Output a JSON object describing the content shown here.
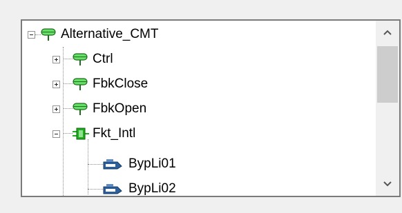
{
  "tree": {
    "items": [
      {
        "label": "Alternative_CMT",
        "icon": "signal-group-icon",
        "expanded": true
      },
      {
        "label": "Ctrl",
        "icon": "signal-group-icon",
        "expanded": false
      },
      {
        "label": "FbkClose",
        "icon": "signal-group-icon",
        "expanded": false
      },
      {
        "label": "FbkOpen",
        "icon": "signal-group-icon",
        "expanded": false
      },
      {
        "label": "Fkt_Intl",
        "icon": "function-block-icon",
        "expanded": true
      },
      {
        "label": "BypLi01",
        "icon": "signal-tag-icon"
      },
      {
        "label": "BypLi02",
        "icon": "signal-tag-icon"
      }
    ]
  },
  "scrollbar": {
    "up_icon": "chevron-up-icon",
    "down_icon": "chevron-down-icon"
  },
  "colors": {
    "group_green": "#66e066",
    "block_green": "#1fae1f",
    "tag_blue": "#2d5f9a",
    "thumb": "#cdcdcd"
  }
}
